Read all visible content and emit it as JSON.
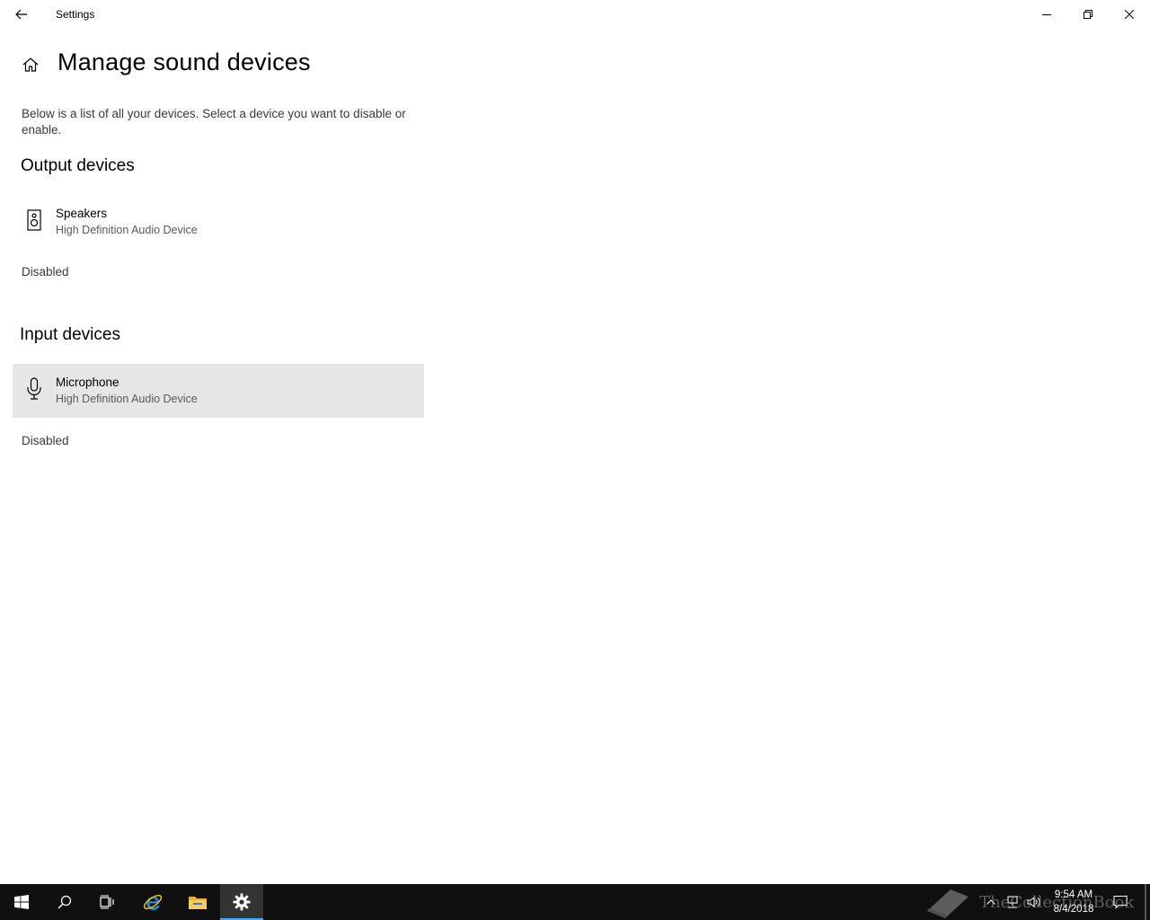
{
  "window": {
    "title": "Settings",
    "back_icon": "back-arrow-icon",
    "controls": [
      "minimize-icon",
      "maximize-icon",
      "close-icon"
    ]
  },
  "page": {
    "title": "Manage sound devices",
    "description": "Below is a list of all your devices. Select a device you want to disable or enable."
  },
  "output": {
    "heading": "Output devices",
    "device": {
      "name": "Speakers",
      "description": "High Definition Audio Device",
      "icon": "speaker-icon"
    },
    "status": "Disabled"
  },
  "input": {
    "heading": "Input devices",
    "device": {
      "name": "Microphone",
      "description": "High Definition Audio Device",
      "icon": "microphone-icon",
      "selected": true
    },
    "status": "Disabled"
  },
  "taskbar": {
    "pinned": [
      "start-icon",
      "search-icon",
      "task-view-icon",
      "internet-explorer-icon",
      "file-explorer-icon",
      "settings-icon"
    ],
    "active": "settings-icon",
    "clock": {
      "time": "9:54 AM",
      "date": "8/4/2018"
    },
    "watermark": "TheCollectionBook"
  },
  "colors": {
    "selected_bg": "#e6e6e6",
    "taskbar_bg": "#101010",
    "active_indicator": "#4aa3ff"
  }
}
